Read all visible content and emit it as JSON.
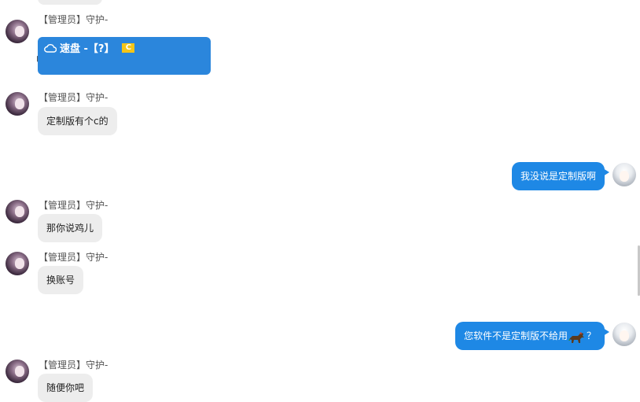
{
  "messages": {
    "sender_name": "【管理员】守护-",
    "card": {
      "title": "速盘 -【?】",
      "badge": "C",
      "side_char": "山"
    },
    "m1": "定制版有个c的",
    "m2": "我没说是定制版啊",
    "m3": "那你说鸡儿",
    "m4": "换账号",
    "m5": "您软件不是定制版不给用",
    "m5_suffix": "？",
    "m6": "随便你吧"
  },
  "colors": {
    "my_bubble": "#1e88e5",
    "their_bubble": "#ededed",
    "card": "#2b86dc",
    "badge": "#f5c518"
  }
}
